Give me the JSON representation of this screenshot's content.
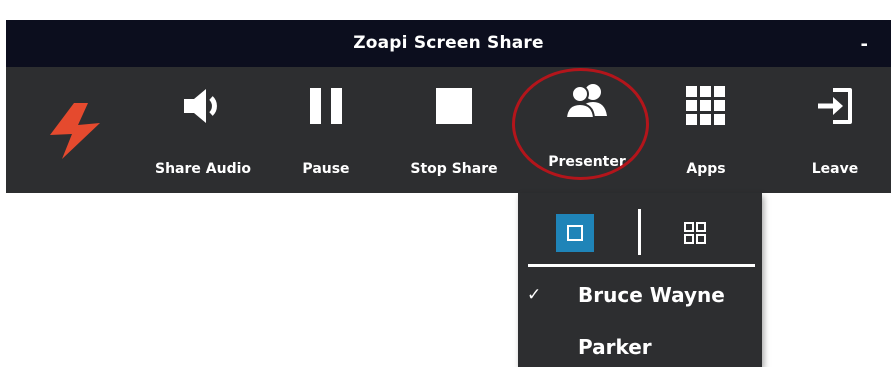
{
  "window": {
    "title": "Zoapi Screen Share",
    "minimize_label": "-"
  },
  "toolbar": {
    "share_audio_label": "Share Audio",
    "pause_label": "Pause",
    "stop_share_label": "Stop Share",
    "presenter_label": "Presenter",
    "apps_label": "Apps",
    "leave_label": "Leave"
  },
  "presenter_menu": {
    "selected_view": "single",
    "people": [
      {
        "name": "Bruce Wayne",
        "checked": true,
        "check_mark": "✓"
      },
      {
        "name": "Parker",
        "checked": false,
        "check_mark": ""
      }
    ]
  },
  "colors": {
    "titlebar_bg": "#0c0e1e",
    "toolbar_bg": "#2d2e30",
    "logo_accent": "#e54a2e",
    "selected_view_bg": "#1f84b8",
    "highlight_circle": "#b3151b"
  },
  "icons": {
    "logo": "lightning-bolt-icon",
    "share_audio": "speaker-icon",
    "pause": "pause-icon",
    "stop_share": "stop-icon",
    "presenter": "users-icon",
    "apps": "grid-icon",
    "leave": "exit-icon",
    "view_single": "single-view-icon",
    "view_grid": "grid-view-icon"
  }
}
